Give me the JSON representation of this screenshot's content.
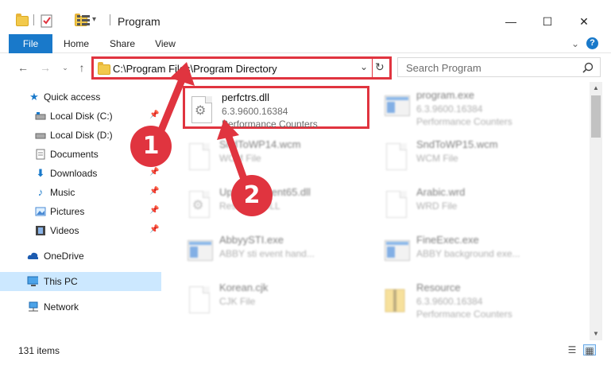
{
  "window": {
    "title": "Program",
    "minimize_glyph": "—",
    "maximize_glyph": "☐",
    "close_glyph": "✕"
  },
  "ribbon": {
    "tabs": [
      {
        "label": "File"
      },
      {
        "label": "Home"
      },
      {
        "label": "Share"
      },
      {
        "label": "View"
      }
    ],
    "expand_glyph": "⌄",
    "help_glyph": "?"
  },
  "address": {
    "path": "C:\\Program Files\\Program Directory",
    "search_placeholder": "Search Program"
  },
  "nav": {
    "items": [
      {
        "label": "Quick access",
        "icon": "star-icon"
      },
      {
        "label": "Local Disk (C:)",
        "icon": "drive-icon",
        "pinned": true
      },
      {
        "label": "Local Disk (D:)",
        "icon": "drive-icon"
      },
      {
        "label": "Documents",
        "icon": "documents-icon",
        "pinned": true
      },
      {
        "label": "Downloads",
        "icon": "download-icon",
        "pinned": true
      },
      {
        "label": "Music",
        "icon": "music-icon",
        "pinned": true
      },
      {
        "label": "Pictures",
        "icon": "pictures-icon",
        "pinned": true
      },
      {
        "label": "Videos",
        "icon": "videos-icon",
        "pinned": true
      },
      {
        "label": "OneDrive",
        "icon": "cloud-icon"
      },
      {
        "label": "This PC",
        "icon": "computer-icon",
        "selected": true
      },
      {
        "label": "Network",
        "icon": "network-icon"
      }
    ]
  },
  "files": [
    {
      "name": "perfctrs.dll",
      "line1": "6.3.9600.16384",
      "line2": "Performance Counters",
      "icon": "dll-gear-icon",
      "highlighted": true
    },
    {
      "name": "program.exe",
      "line1": "6.3.9600.16384",
      "line2": "Performance Counters",
      "icon": "exe-icon"
    },
    {
      "name": "SndToWP14.wcm",
      "line1": "WCM File",
      "line2": "",
      "icon": "document-icon"
    },
    {
      "name": "SndToWP15.wcm",
      "line1": "WCM File",
      "line2": "",
      "icon": "document-icon"
    },
    {
      "name": "UpgradeAgent65.dll",
      "line1": "Resource DLL",
      "line2": "",
      "icon": "dll-gear-icon"
    },
    {
      "name": "Arabic.wrd",
      "line1": "WRD File",
      "line2": "",
      "icon": "document-icon"
    },
    {
      "name": "AbbyySTI.exe",
      "line1": "ABBY sti event hand...",
      "line2": "",
      "icon": "exe-icon"
    },
    {
      "name": "FineExec.exe",
      "line1": "ABBY background exe...",
      "line2": "",
      "icon": "exe-icon"
    },
    {
      "name": "Korean.cjk",
      "line1": "CJK File",
      "line2": "",
      "icon": "document-icon"
    },
    {
      "name": "Resource",
      "line1": "6.3.9600.16384",
      "line2": "Performance Counters",
      "icon": "archive-icon"
    }
  ],
  "status": {
    "item_count": "131 items"
  },
  "annotations": {
    "badge1": "1",
    "badge2": "2",
    "color": "#e0343f"
  }
}
